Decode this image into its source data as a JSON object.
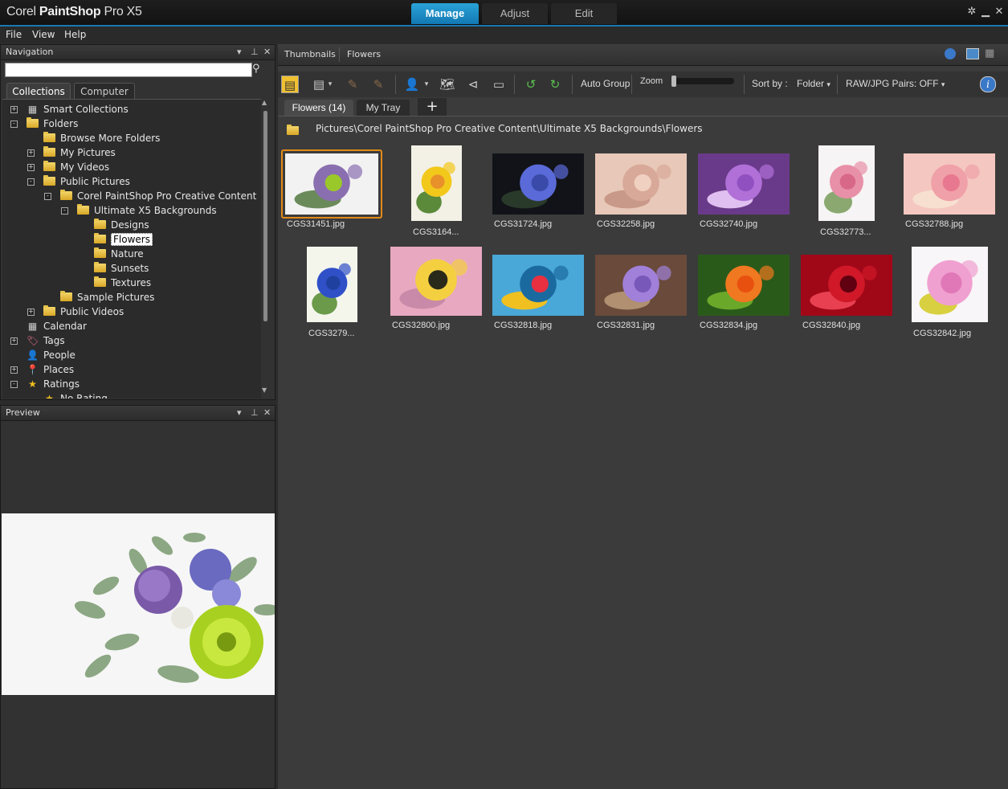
{
  "title_bar": {
    "app_name_a": "Corel",
    "app_name_b": "PaintShop",
    "app_name_c": "Pro X5",
    "tabs": [
      "Manage",
      "Adjust",
      "Edit"
    ],
    "active_tab": "Manage"
  },
  "menu": [
    "File",
    "View",
    "Help"
  ],
  "navigation": {
    "title": "Navigation",
    "tabs": [
      "Collections",
      "Computer"
    ],
    "tree": [
      {
        "label": "Smart Collections",
        "level": 0,
        "exp": "+",
        "icon": "calendar-icon"
      },
      {
        "label": "Folders",
        "level": 0,
        "exp": "-",
        "icon": "folder-icon"
      },
      {
        "label": "Browse More Folders",
        "level": 1,
        "exp": "",
        "icon": "folder-add-icon"
      },
      {
        "label": "My Pictures",
        "level": 1,
        "exp": "+",
        "icon": "folder-icon"
      },
      {
        "label": "My Videos",
        "level": 1,
        "exp": "+",
        "icon": "folder-icon"
      },
      {
        "label": "Public Pictures",
        "level": 1,
        "exp": "-",
        "icon": "folder-icon"
      },
      {
        "label": "Corel PaintShop Pro Creative Content",
        "level": 2,
        "exp": "-",
        "icon": "folder-icon"
      },
      {
        "label": "Ultimate X5 Backgrounds",
        "level": 3,
        "exp": "-",
        "icon": "folder-icon"
      },
      {
        "label": "Designs",
        "level": 4,
        "exp": "",
        "icon": "folder-icon"
      },
      {
        "label": "Flowers",
        "level": 4,
        "exp": "",
        "icon": "folder-icon",
        "selected": true
      },
      {
        "label": "Nature",
        "level": 4,
        "exp": "",
        "icon": "folder-icon"
      },
      {
        "label": "Sunsets",
        "level": 4,
        "exp": "",
        "icon": "folder-icon"
      },
      {
        "label": "Textures",
        "level": 4,
        "exp": "",
        "icon": "folder-icon"
      },
      {
        "label": "Sample Pictures",
        "level": 2,
        "exp": "",
        "icon": "folder-icon"
      },
      {
        "label": "Public Videos",
        "level": 1,
        "exp": "+",
        "icon": "folder-icon"
      },
      {
        "label": "Calendar",
        "level": 0,
        "exp": "",
        "icon": "calendar-icon"
      },
      {
        "label": "Tags",
        "level": 0,
        "exp": "+",
        "icon": "tag-icon"
      },
      {
        "label": "People",
        "level": 0,
        "exp": "",
        "icon": "person-icon"
      },
      {
        "label": "Places",
        "level": 0,
        "exp": "+",
        "icon": "pin-icon"
      },
      {
        "label": "Ratings",
        "level": 0,
        "exp": "-",
        "icon": "star-icon"
      },
      {
        "label": "No Rating",
        "level": 1,
        "exp": "",
        "icon": "star-icon"
      }
    ]
  },
  "preview": {
    "title": "Preview"
  },
  "main": {
    "header_tabs": [
      "Thumbnails",
      "Flowers"
    ],
    "toolbar": {
      "auto_group": "Auto Group",
      "zoom": "Zoom",
      "sort_by": "Sort by :",
      "sort_value": "Folder",
      "raw_jpg": "RAW/JPG Pairs: OFF"
    },
    "trays": [
      "Flowers (14)",
      "My Tray"
    ],
    "path": "Pictures\\Corel PaintShop Pro Creative Content\\Ultimate X5 Backgrounds\\Flowers",
    "thumbnails": [
      {
        "name": "CGS31451.jpg",
        "colors": [
          "#f2f2f2",
          "#8a6fb0",
          "#9ac82a",
          "#6a8a5a"
        ]
      },
      {
        "name": "CGS3164...",
        "colors": [
          "#f3f0e6",
          "#f2c81a",
          "#e8902a",
          "#5a8a3a"
        ]
      },
      {
        "name": "CGS31724.jpg",
        "colors": [
          "#111318",
          "#5a6ad8",
          "#3a4aa8",
          "#2a3a2a"
        ]
      },
      {
        "name": "CGS32258.jpg",
        "colors": [
          "#e8c8b8",
          "#d8a898",
          "#f0d0c0",
          "#c89888"
        ]
      },
      {
        "name": "CGS32740.jpg",
        "colors": [
          "#6a3a8a",
          "#b070d8",
          "#9050c0",
          "#e0c0f0"
        ]
      },
      {
        "name": "CGS32773...",
        "colors": [
          "#f6f4f4",
          "#e890a8",
          "#d86888",
          "#8aa870"
        ]
      },
      {
        "name": "CGS32788.jpg",
        "colors": [
          "#f4c8c0",
          "#f0a0a8",
          "#e87890",
          "#f8e0d0"
        ]
      },
      {
        "name": "CGS3279...",
        "colors": [
          "#f4f6ec",
          "#3050c8",
          "#2040a0",
          "#6a9a4a"
        ]
      },
      {
        "name": "CGS32800.jpg",
        "colors": [
          "#e8a8c0",
          "#f4d040",
          "#2a2a1a",
          "#c88aa8"
        ]
      },
      {
        "name": "CGS32818.jpg",
        "colors": [
          "#4aa8d8",
          "#1a6aa0",
          "#e83040",
          "#f0c020"
        ]
      },
      {
        "name": "CGS32831.jpg",
        "colors": [
          "#6a4a3a",
          "#a080d8",
          "#7858b8",
          "#b09070"
        ]
      },
      {
        "name": "CGS32834.jpg",
        "colors": [
          "#2a5a1a",
          "#f07820",
          "#e85010",
          "#6aa82a"
        ]
      },
      {
        "name": "CGS32840.jpg",
        "colors": [
          "#a00818",
          "#d01828",
          "#600010",
          "#e84050"
        ]
      },
      {
        "name": "CGS32842.jpg",
        "colors": [
          "#f8f6f8",
          "#f0a0d0",
          "#e078b8",
          "#d8d040"
        ]
      }
    ]
  }
}
